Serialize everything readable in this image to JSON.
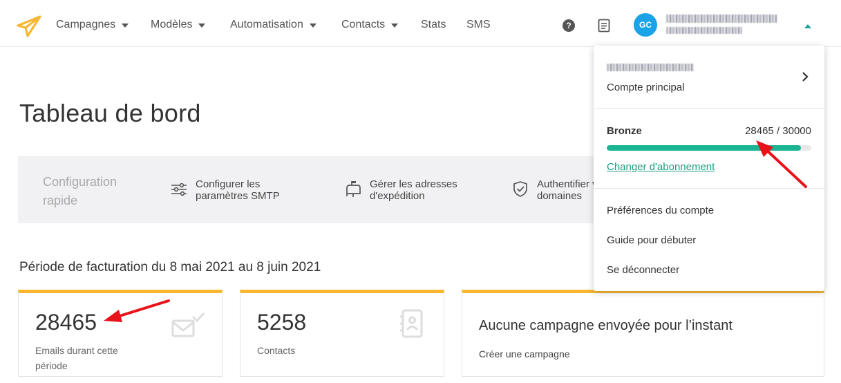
{
  "nav": {
    "items": [
      {
        "label": "Campagnes",
        "has_caret": true
      },
      {
        "label": "Modèles",
        "has_caret": true
      },
      {
        "label": "Automatisation",
        "has_caret": true
      },
      {
        "label": "Contacts",
        "has_caret": true
      },
      {
        "label": "Stats",
        "has_caret": false
      },
      {
        "label": "SMS",
        "has_caret": false
      }
    ],
    "help_glyph": "?",
    "avatar_initials": "GC",
    "icons": [
      "paper-plane-logo-icon",
      "help-circle-icon",
      "document-icon",
      "caret-up-icon"
    ]
  },
  "page": {
    "title": "Tableau de bord"
  },
  "quick_setup": {
    "title": "Configuration rapide",
    "items": [
      {
        "label": "Configurer les paramètres SMTP",
        "icon": "sliders-icon"
      },
      {
        "label": "Gérer les adresses d'expédition",
        "icon": "mailbox-icon"
      },
      {
        "label": "Authentifier vos domaines",
        "icon": "shield-check-icon"
      }
    ]
  },
  "billing": {
    "period_label": "Période de facturation du 8 mai 2021 au 8 juin 2021"
  },
  "cards": {
    "emails": {
      "value": "28465",
      "label": "Emails durant cette période",
      "icon": "envelope-check-icon"
    },
    "contacts": {
      "value": "5258",
      "label": "Contacts",
      "icon": "address-book-icon"
    },
    "campaigns": {
      "heading": "Aucune campagne envoyée pour l’instant",
      "link": "Créer une campagne"
    }
  },
  "account_menu": {
    "account_subtitle": "Compte principal",
    "plan": {
      "name": "Bronze",
      "used": 28465,
      "limit": 30000,
      "count_label": "28465 / 30000",
      "usage_fraction": 0.9488
    },
    "change_plan_link": "Changer d'abonnement",
    "items": [
      "Préférences du compte",
      "Guide pour débuter",
      "Se déconnecter"
    ]
  },
  "colors": {
    "accent_orange": "#f7b731",
    "progress_green": "#1bb596",
    "link_green": "#1b9e84",
    "avatar_blue": "#1aa3e8",
    "annotation_red": "#e8121b"
  }
}
